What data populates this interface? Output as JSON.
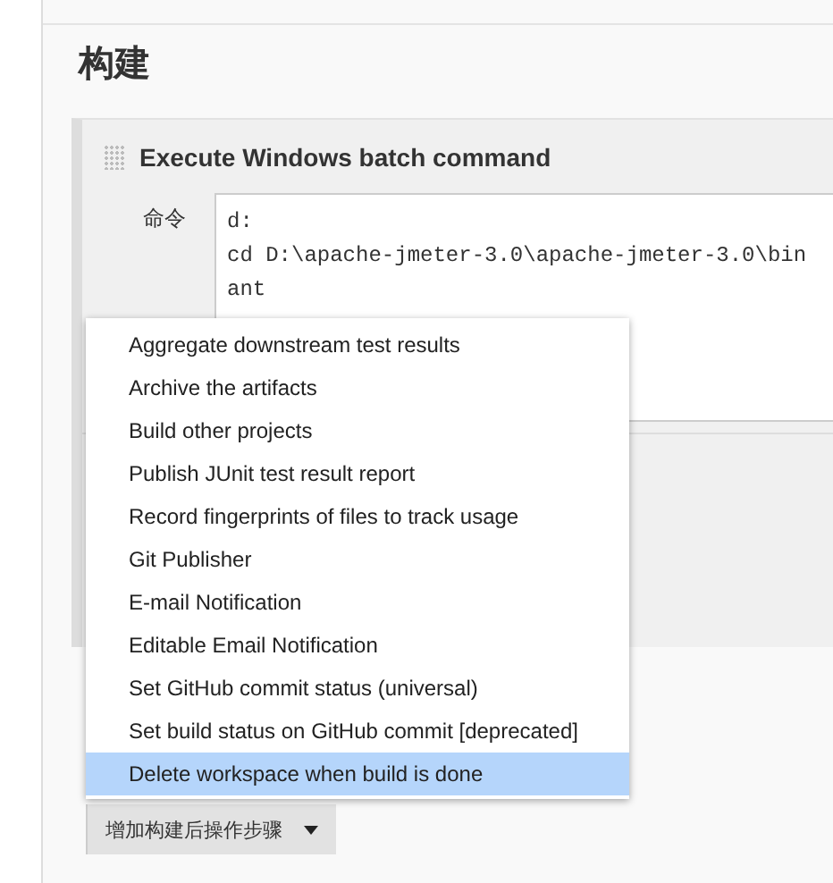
{
  "section": {
    "title": "构建"
  },
  "build_step": {
    "title": "Execute Windows batch command",
    "field_label": "命令",
    "command_lines": [
      "d:",
      "cd D:\\apache-jmeter-3.0\\apache-jmeter-3.0\\bin",
      "ant"
    ]
  },
  "dropdown_menu": {
    "items": [
      {
        "label": "Aggregate downstream test results",
        "selected": false
      },
      {
        "label": "Archive the artifacts",
        "selected": false
      },
      {
        "label": "Build other projects",
        "selected": false
      },
      {
        "label": "Publish JUnit test result report",
        "selected": false
      },
      {
        "label": "Record fingerprints of files to track usage",
        "selected": false
      },
      {
        "label": "Git Publisher",
        "selected": false
      },
      {
        "label": "E-mail Notification",
        "selected": false
      },
      {
        "label": "Editable Email Notification",
        "selected": false
      },
      {
        "label": "Set GitHub commit status (universal)",
        "selected": false
      },
      {
        "label": "Set build status on GitHub commit [deprecated]",
        "selected": false
      },
      {
        "label": "Delete workspace when build is done",
        "selected": true
      }
    ]
  },
  "add_post_build_button": {
    "label": "增加构建后操作步骤"
  }
}
